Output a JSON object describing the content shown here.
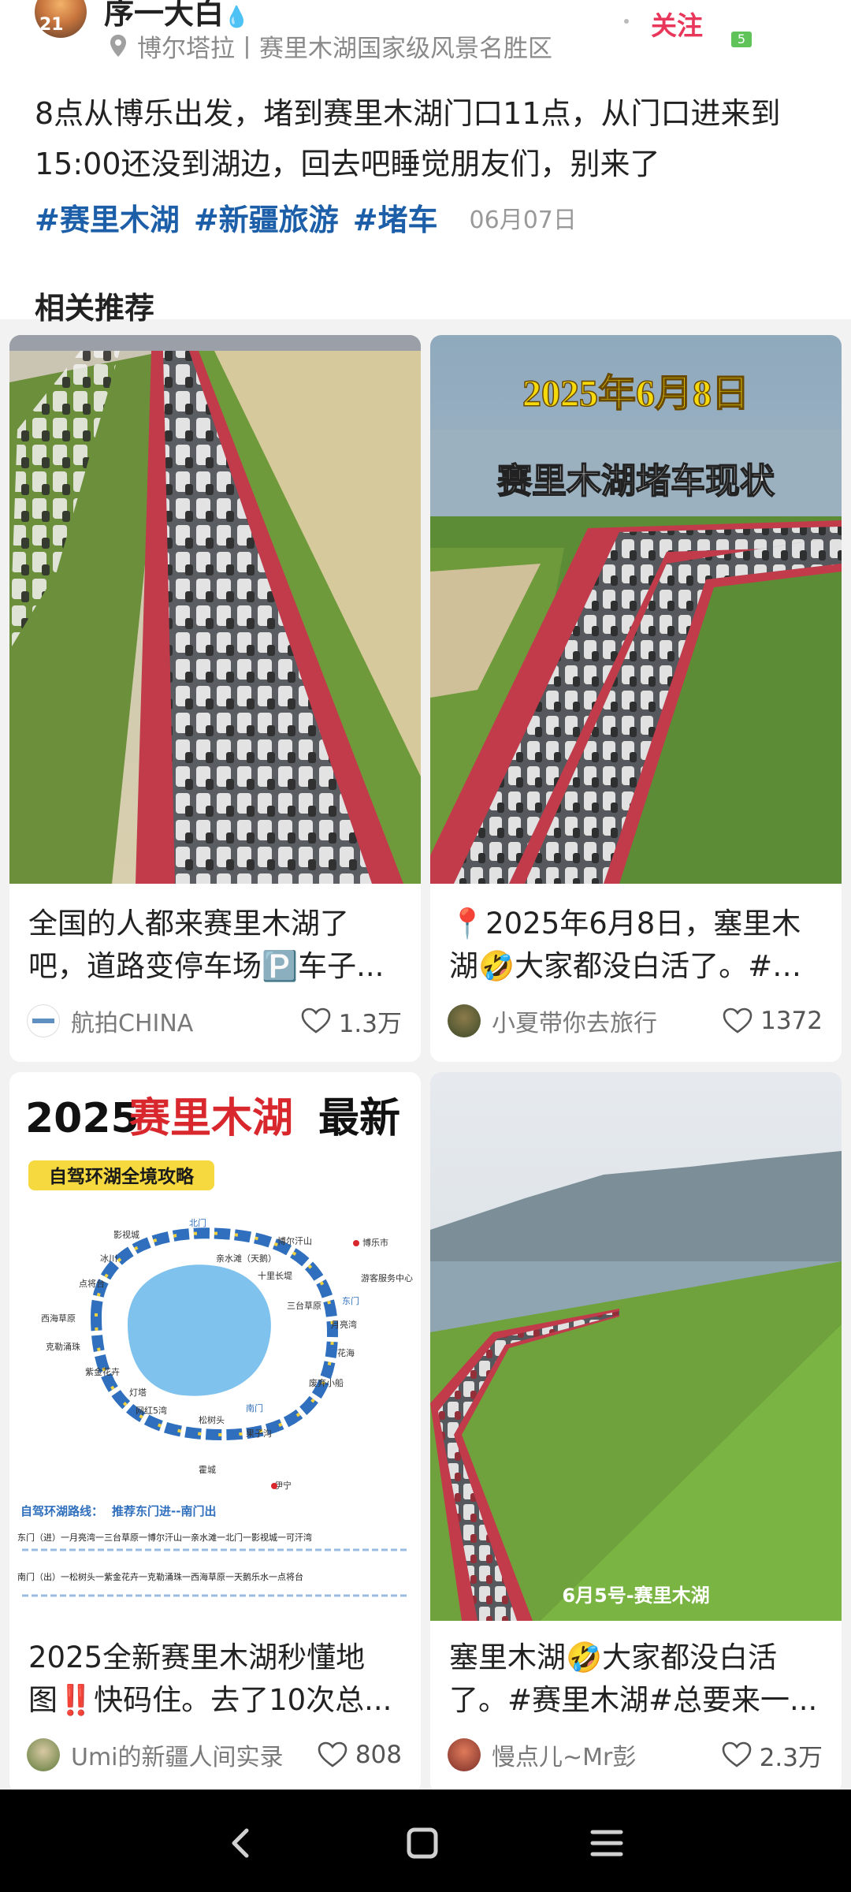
{
  "post": {
    "author_name": "序一大白",
    "author_avatar_text": "21",
    "location": "博尔塔拉丨赛里木湖国家级风景名胜区",
    "follow_label": "关注",
    "badge_text": "5",
    "text": "8点从博乐出发，堵到赛里木湖门口11点，从门口进来到15:00还没到湖边，回去吧睡觉朋友们，别来了",
    "tags": [
      "#赛里木湖",
      "#新疆旅游",
      "#堵车"
    ],
    "date": "06月07日"
  },
  "section_title": "相关推荐",
  "cards": [
    {
      "title": "全国的人都来赛里木湖了吧，道路变停车场🅿️车子...",
      "author": "航拍CHINA",
      "likes": "1.3万"
    },
    {
      "title": "📍2025年6月8日，塞里木湖🤣大家都没白活了。#赛...",
      "overlay_line1": "2025年6月8日",
      "overlay_line2": "赛里木湖堵车现状",
      "author": "小夏带你去旅行",
      "likes": "1372"
    },
    {
      "title": "2025全新赛里木湖秒懂地图‼️快码住。去了10次总...",
      "map_title_prefix": "2025",
      "map_title_red": "赛里木湖",
      "map_title_suffix": "最新",
      "map_subtitle": "自驾环湖全境攻略",
      "map_route_label": "自驾环湖路线：",
      "map_route_recommend": "推荐东门进--南门出",
      "map_route_east": "东门（进）一月亮湾一三台草原一博尔汗山一亲水滩一北门一影视城一可汗湾",
      "map_route_south": "南门（出）一松树头一紫金花卉一克勒涌珠一西海草原一天鹅乐水一点将台",
      "map_labels": [
        "影视城",
        "北门",
        "亲水滩（天鹅）",
        "十里长堤",
        "三台草原",
        "东门",
        "月亮湾",
        "花海",
        "废弃小船",
        "南门",
        "松树头",
        "果子沟",
        "霍城",
        "伊宁",
        "网红5湾",
        "灯塔",
        "紫金花卉",
        "克勒涌珠",
        "西海草原",
        "点将台",
        "冰川",
        "博乐市",
        "博尔汗山",
        "游客服务中心"
      ],
      "author": "Umi的新疆人间实录",
      "likes": "808"
    },
    {
      "title": "塞里木湖🤣大家都没白活了。#赛里木湖#总要来一...",
      "overlay_caption": "6月5号-赛里木湖",
      "author": "慢点儿~Mr彭",
      "likes": "2.3万"
    }
  ],
  "colors": {
    "accent_red": "#e8375a",
    "tag_blue": "#1c5fa8",
    "road_red": "#c23b4a",
    "grass_green": "#5a8a2e",
    "navbar_bg": "#000000"
  },
  "icons": {
    "location": "map-pin-icon",
    "like": "heart-outline-icon",
    "nav_back": "back-chevron-icon",
    "nav_home": "home-square-icon",
    "nav_menu": "menu-lines-icon"
  }
}
